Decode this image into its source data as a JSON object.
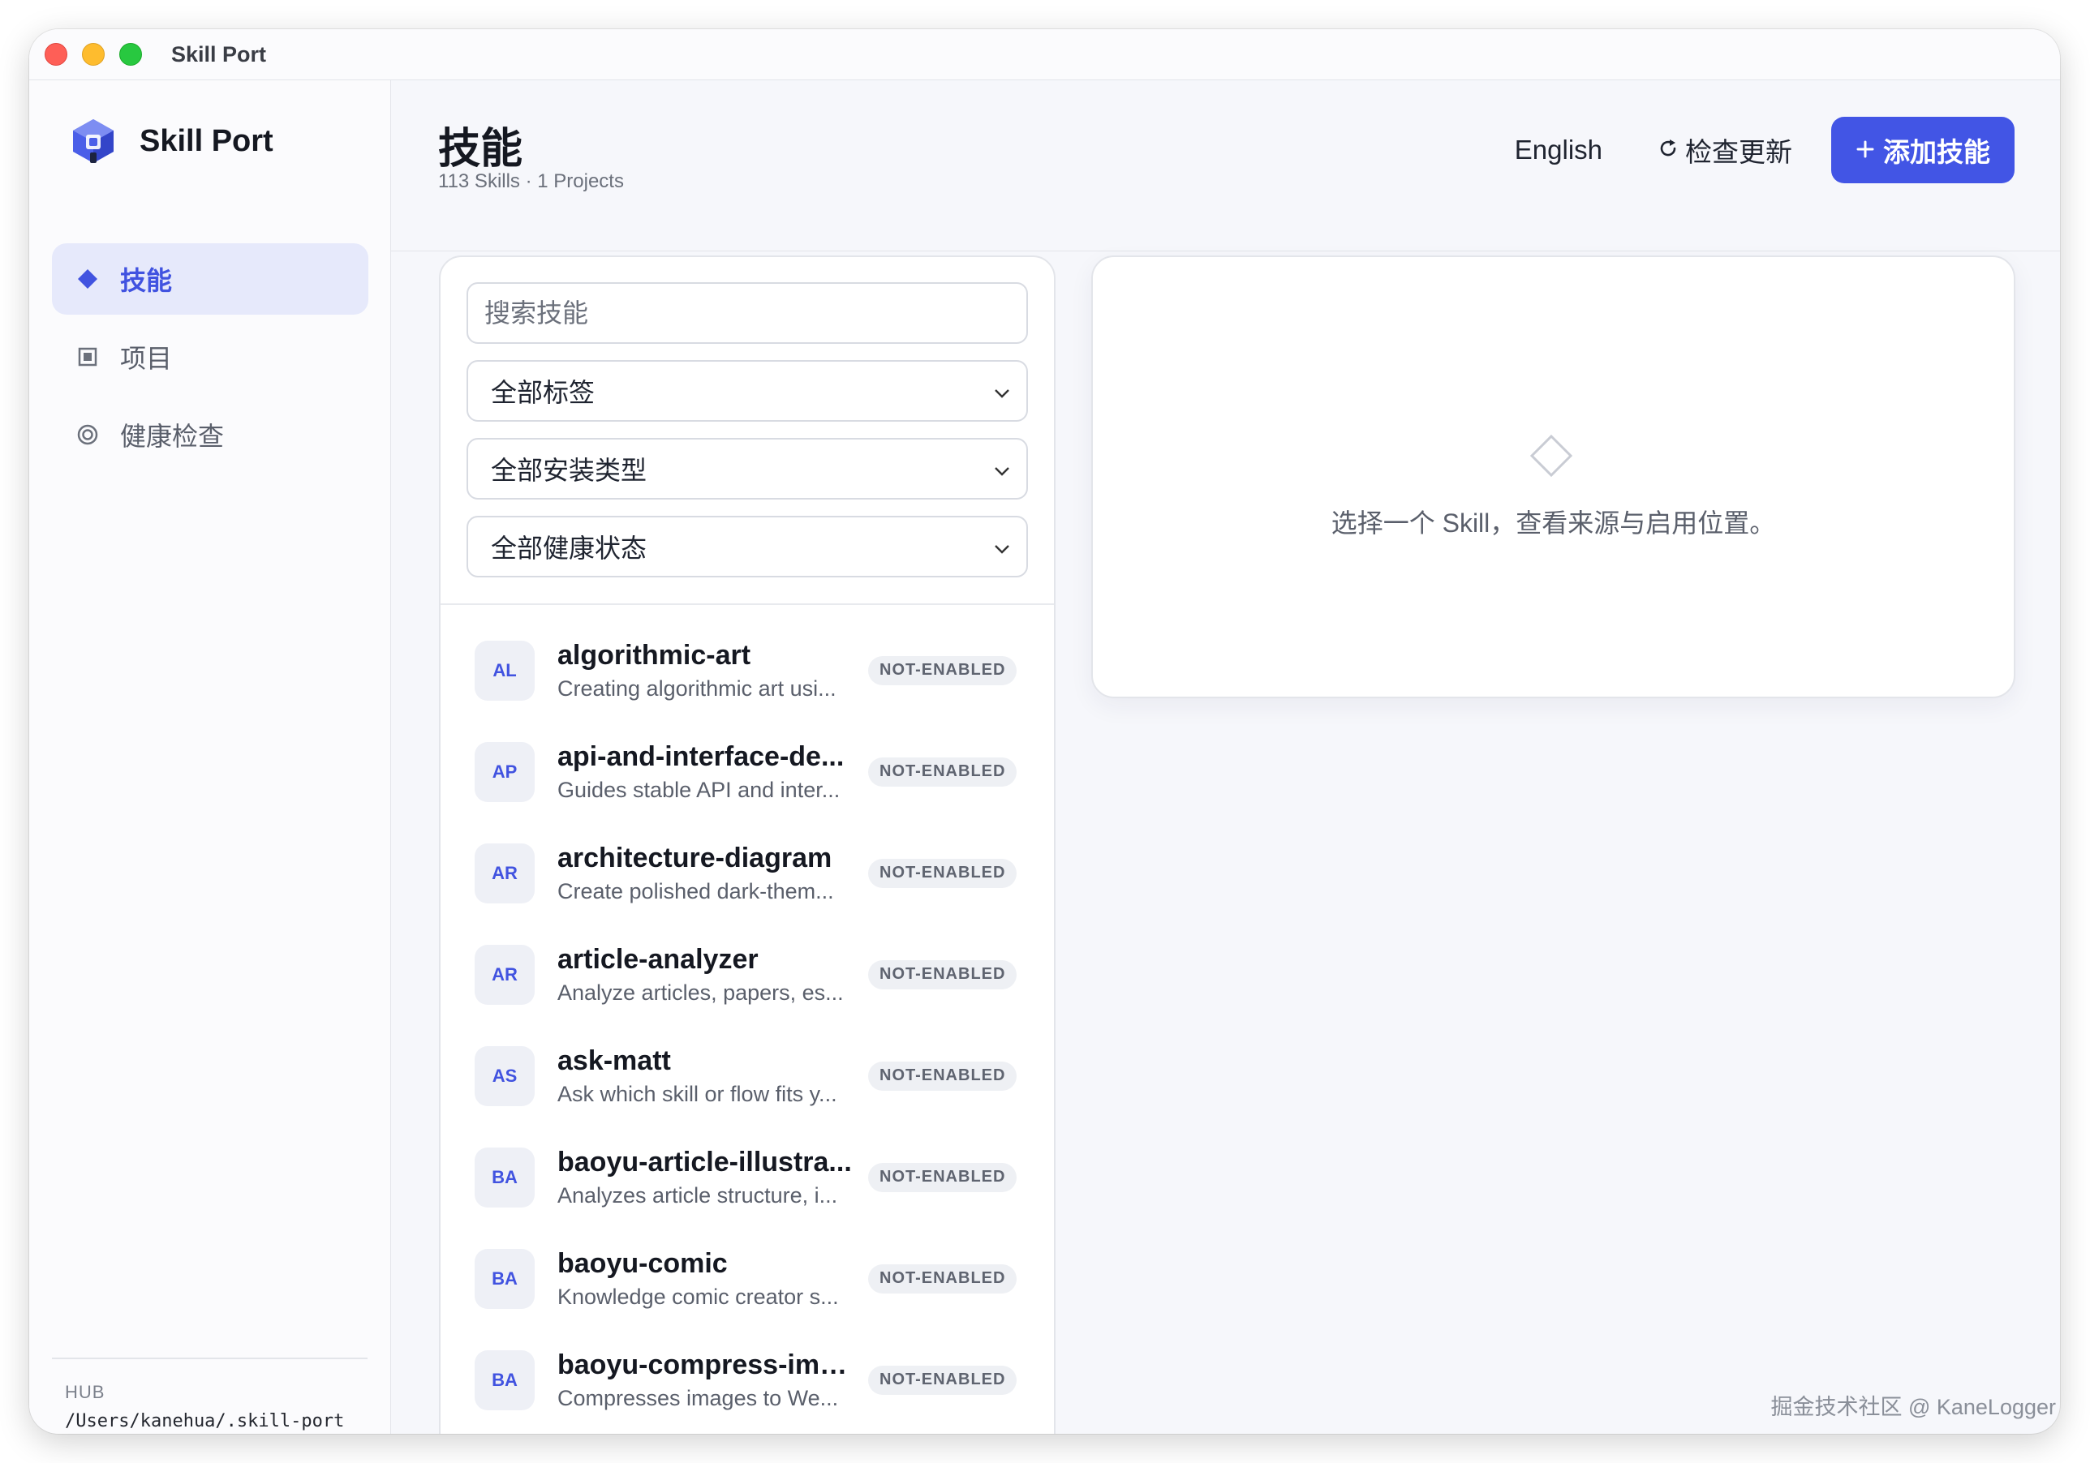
{
  "window": {
    "title": "Skill Port"
  },
  "sidebar": {
    "brand": "Skill Port",
    "items": [
      {
        "label": "技能",
        "icon": "diamond-icon",
        "active": true
      },
      {
        "label": "项目",
        "icon": "square-icon",
        "active": false
      },
      {
        "label": "健康检查",
        "icon": "target-icon",
        "active": false
      }
    ],
    "hub_label": "HUB",
    "hub_path": "/Users/kanehua/.skill-port"
  },
  "header": {
    "title": "技能",
    "subtitle": "113 Skills · 1 Projects",
    "lang_label": "English",
    "check_label": "检查更新",
    "add_label": "添加技能"
  },
  "filters": {
    "search_placeholder": "搜索技能",
    "tag_select": "全部标签",
    "install_select": "全部安装类型",
    "health_select": "全部健康状态"
  },
  "skills": [
    {
      "abbr": "AL",
      "name": "algorithmic-art",
      "desc": "Creating algorithmic art usi...",
      "status": "NOT-ENABLED"
    },
    {
      "abbr": "AP",
      "name": "api-and-interface-de...",
      "desc": "Guides stable API and inter...",
      "status": "NOT-ENABLED"
    },
    {
      "abbr": "AR",
      "name": "architecture-diagram",
      "desc": "Create polished dark-them...",
      "status": "NOT-ENABLED"
    },
    {
      "abbr": "AR",
      "name": "article-analyzer",
      "desc": "Analyze articles, papers, es...",
      "status": "NOT-ENABLED"
    },
    {
      "abbr": "AS",
      "name": "ask-matt",
      "desc": "Ask which skill or flow fits y...",
      "status": "NOT-ENABLED"
    },
    {
      "abbr": "BA",
      "name": "baoyu-article-illustra...",
      "desc": "Analyzes article structure, i...",
      "status": "NOT-ENABLED"
    },
    {
      "abbr": "BA",
      "name": "baoyu-comic",
      "desc": "Knowledge comic creator s...",
      "status": "NOT-ENABLED"
    },
    {
      "abbr": "BA",
      "name": "baoyu-compress-ima...",
      "desc": "Compresses images to We...",
      "status": "NOT-ENABLED"
    }
  ],
  "detail": {
    "empty_text": "选择一个 Skill，查看来源与启用位置。"
  },
  "watermark": "掘金技术社区 @ KaneLogger",
  "colors": {
    "accent": "#4255e5",
    "active_bg": "#e6e9fb",
    "badge_bg": "#eef0f4"
  }
}
